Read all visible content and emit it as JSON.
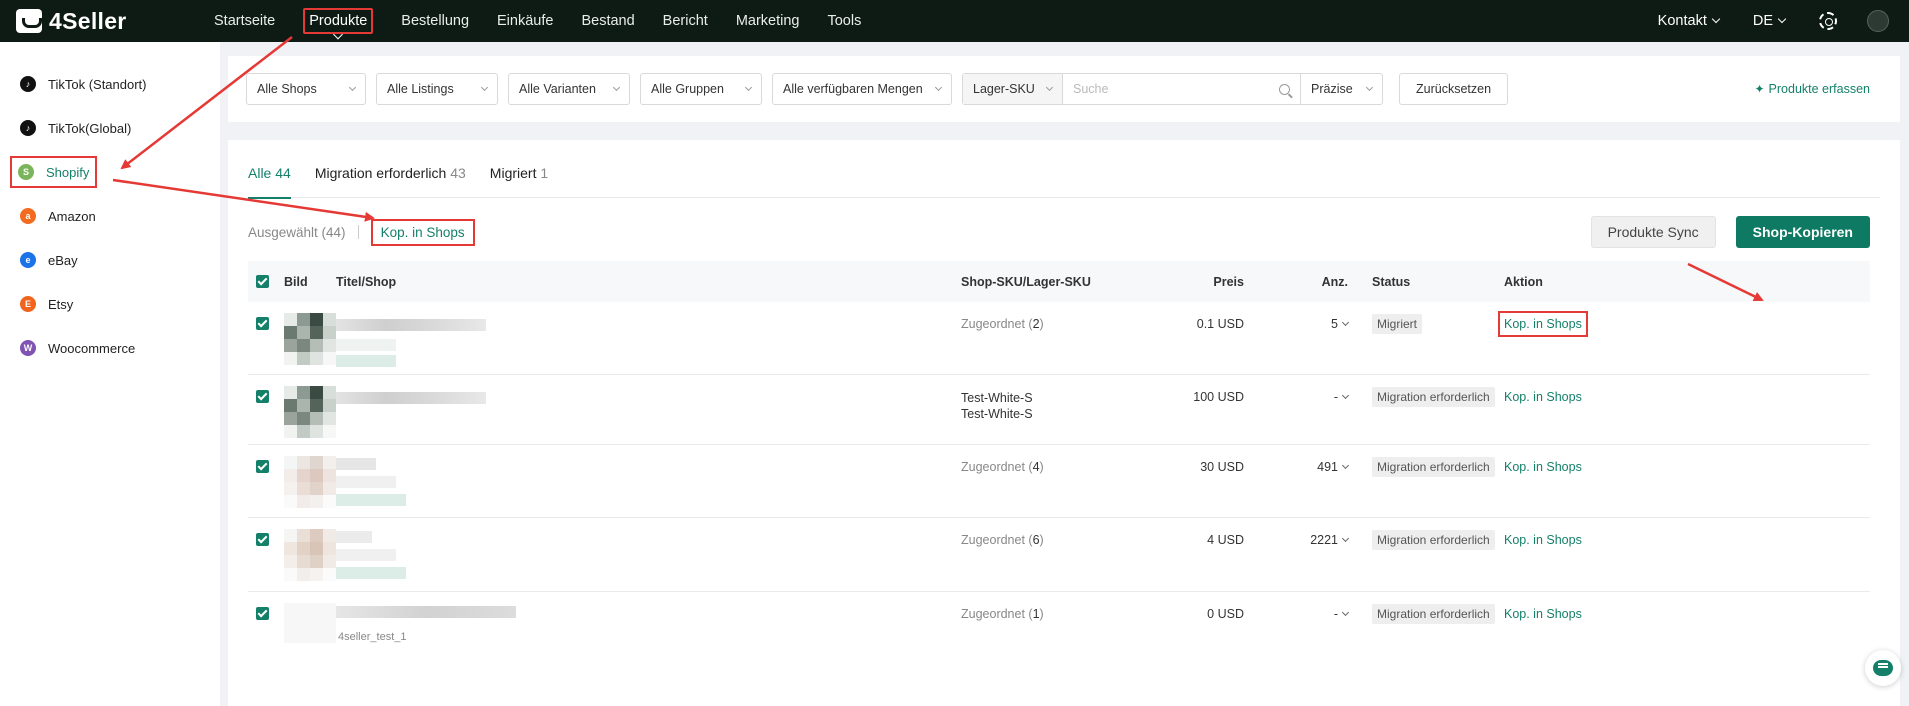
{
  "brand": {
    "name": "4Seller"
  },
  "colors": {
    "accent": "#15806a",
    "topbar": "#0e1a14",
    "highlight": "#e53935"
  },
  "nav": {
    "items": [
      {
        "label": "Startseite",
        "active": false
      },
      {
        "label": "Produkte",
        "active": true
      },
      {
        "label": "Bestellung",
        "active": false
      },
      {
        "label": "Einkäufe",
        "active": false
      },
      {
        "label": "Bestand",
        "active": false
      },
      {
        "label": "Bericht",
        "active": false
      },
      {
        "label": "Marketing",
        "active": false
      },
      {
        "label": "Tools",
        "active": false
      }
    ],
    "kontakt": "Kontakt",
    "lang": "DE"
  },
  "sidebar": {
    "items": [
      {
        "label": "TikTok (Standort)",
        "icon": "tiktok-icon",
        "color": "#111111",
        "active": false
      },
      {
        "label": "TikTok(Global)",
        "icon": "tiktok-icon",
        "color": "#111111",
        "active": false
      },
      {
        "label": "Shopify",
        "icon": "shopify-icon",
        "color": "#7ab55c",
        "active": true
      },
      {
        "label": "Amazon",
        "icon": "amazon-icon",
        "color": "#f26b21",
        "active": false
      },
      {
        "label": "eBay",
        "icon": "ebay-icon",
        "color": "#1a73e8",
        "active": false
      },
      {
        "label": "Etsy",
        "icon": "etsy-icon",
        "color": "#f1641e",
        "active": false
      },
      {
        "label": "Woocommerce",
        "icon": "woocommerce-icon",
        "color": "#7f54b3",
        "active": false
      }
    ]
  },
  "filters": {
    "shops": "Alle Shops",
    "listings": "Alle Listings",
    "variants": "Alle Varianten",
    "groups": "Alle Gruppen",
    "quantities": "Alle verfügbaren Mengen",
    "search_field": "Lager-SKU",
    "search_placeholder": "Suche",
    "match_mode": "Präzise",
    "reset": "Zurücksetzen",
    "add_products": "Produkte erfassen"
  },
  "tabs": [
    {
      "label": "Alle",
      "count": "44",
      "active": true
    },
    {
      "label": "Migration erforderlich",
      "count": "43",
      "active": false
    },
    {
      "label": "Migriert",
      "count": "1",
      "active": false
    }
  ],
  "actions": {
    "selected": "Ausgewählt (44)",
    "copy_to_shops": "Kop. in Shops",
    "sync": "Produkte Sync",
    "shop_copy": "Shop-Kopieren"
  },
  "table": {
    "headers": {
      "image": "Bild",
      "title": "Titel/Shop",
      "sku": "Shop-SKU/Lager-SKU",
      "price": "Preis",
      "qty": "Anz.",
      "status": "Status",
      "action": "Aktion"
    },
    "rows": [
      {
        "sku_label": "Zugeordnet",
        "sku_count": "2",
        "sku_lines": [],
        "price": "0.1 USD",
        "qty": "5",
        "status": "Migriert",
        "action": "Kop. in Shops"
      },
      {
        "sku_label": "",
        "sku_count": "",
        "sku_lines": [
          "Test-White-S",
          "Test-White-S"
        ],
        "price": "100 USD",
        "qty": "-",
        "status": "Migration erforderlich",
        "action": "Kop. in Shops"
      },
      {
        "sku_label": "Zugeordnet",
        "sku_count": "4",
        "sku_lines": [],
        "price": "30 USD",
        "qty": "491",
        "status": "Migration erforderlich",
        "action": "Kop. in Shops"
      },
      {
        "sku_label": "Zugeordnet",
        "sku_count": "6",
        "sku_lines": [],
        "price": "4 USD",
        "qty": "2221",
        "status": "Migration erforderlich",
        "action": "Kop. in Shops"
      },
      {
        "sku_label": "Zugeordnet",
        "sku_count": "1",
        "sku_lines": [],
        "price": "0 USD",
        "qty": "-",
        "status": "Migration erforderlich",
        "action": "Kop. in Shops"
      }
    ],
    "partial_title": "4seller_test_1"
  }
}
